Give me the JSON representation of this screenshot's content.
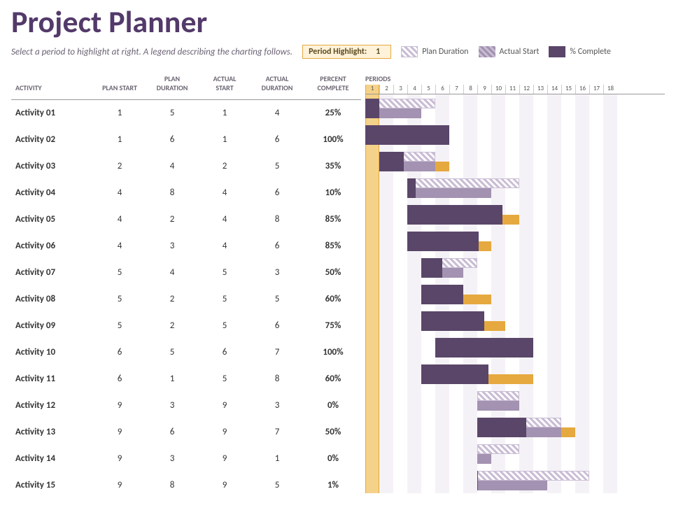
{
  "title": "Project Planner",
  "instructions": "Select a period to highlight at right.  A legend describing the charting follows.",
  "period_highlight": {
    "label": "Period Highlight:",
    "value": 1
  },
  "legend": {
    "plan_duration": "Plan Duration",
    "actual_start": "Actual Start",
    "pct_complete": "% Complete"
  },
  "columns": {
    "activity": "ACTIVITY",
    "plan_start": "PLAN START",
    "plan_duration": "PLAN DURATION",
    "actual_start": "ACTUAL START",
    "actual_duration": "ACTUAL DURATION",
    "percent_complete": "PERCENT COMPLETE",
    "periods": "PERIODS"
  },
  "periods": 18,
  "chart_data": {
    "type": "gantt",
    "x_unit": "period",
    "x_range": [
      1,
      18
    ],
    "highlight_period": 1,
    "series_legend": [
      "Plan Duration",
      "Actual Start",
      "% Complete"
    ],
    "rows": [
      {
        "activity": "Activity 01",
        "plan_start": 1,
        "plan_duration": 5,
        "actual_start": 1,
        "actual_duration": 4,
        "percent_complete": 25
      },
      {
        "activity": "Activity 02",
        "plan_start": 1,
        "plan_duration": 6,
        "actual_start": 1,
        "actual_duration": 6,
        "percent_complete": 100
      },
      {
        "activity": "Activity 03",
        "plan_start": 2,
        "plan_duration": 4,
        "actual_start": 2,
        "actual_duration": 5,
        "percent_complete": 35
      },
      {
        "activity": "Activity 04",
        "plan_start": 4,
        "plan_duration": 8,
        "actual_start": 4,
        "actual_duration": 6,
        "percent_complete": 10
      },
      {
        "activity": "Activity 05",
        "plan_start": 4,
        "plan_duration": 2,
        "actual_start": 4,
        "actual_duration": 8,
        "percent_complete": 85
      },
      {
        "activity": "Activity 06",
        "plan_start": 4,
        "plan_duration": 3,
        "actual_start": 4,
        "actual_duration": 6,
        "percent_complete": 85
      },
      {
        "activity": "Activity 07",
        "plan_start": 5,
        "plan_duration": 4,
        "actual_start": 5,
        "actual_duration": 3,
        "percent_complete": 50
      },
      {
        "activity": "Activity 08",
        "plan_start": 5,
        "plan_duration": 2,
        "actual_start": 5,
        "actual_duration": 5,
        "percent_complete": 60
      },
      {
        "activity": "Activity 09",
        "plan_start": 5,
        "plan_duration": 2,
        "actual_start": 5,
        "actual_duration": 6,
        "percent_complete": 75
      },
      {
        "activity": "Activity 10",
        "plan_start": 6,
        "plan_duration": 5,
        "actual_start": 6,
        "actual_duration": 7,
        "percent_complete": 100
      },
      {
        "activity": "Activity 11",
        "plan_start": 6,
        "plan_duration": 1,
        "actual_start": 5,
        "actual_duration": 8,
        "percent_complete": 60
      },
      {
        "activity": "Activity 12",
        "plan_start": 9,
        "plan_duration": 3,
        "actual_start": 9,
        "actual_duration": 3,
        "percent_complete": 0
      },
      {
        "activity": "Activity 13",
        "plan_start": 9,
        "plan_duration": 6,
        "actual_start": 9,
        "actual_duration": 7,
        "percent_complete": 50
      },
      {
        "activity": "Activity 14",
        "plan_start": 9,
        "plan_duration": 3,
        "actual_start": 9,
        "actual_duration": 1,
        "percent_complete": 0
      },
      {
        "activity": "Activity 15",
        "plan_start": 9,
        "plan_duration": 8,
        "actual_start": 9,
        "actual_duration": 5,
        "percent_complete": 1
      }
    ]
  }
}
